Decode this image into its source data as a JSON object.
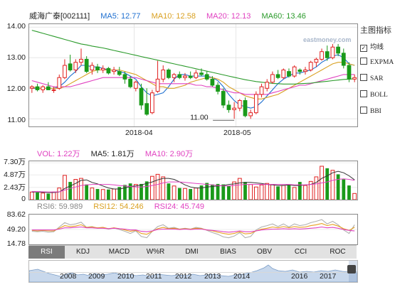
{
  "header": {
    "name": "威海广泰[002111]",
    "ma5": "MA5: 12.77",
    "ma10": "MA10: 12.58",
    "ma20": "MA20: 12.13",
    "ma60": "MA60: 13.46"
  },
  "price_axis": {
    "ticks": [
      "14.00",
      "13.00",
      "12.00",
      "11.00"
    ]
  },
  "date_axis": {
    "ticks": [
      "2018-04",
      "2018-05"
    ]
  },
  "annotations": {
    "low": "11.00"
  },
  "watermark": "eastmoney.com",
  "side_panel": {
    "title": "主图指标",
    "items": [
      {
        "label": "均线",
        "checked": true
      },
      {
        "label": "EXPMA",
        "checked": false
      },
      {
        "label": "SAR",
        "checked": false
      },
      {
        "label": "BOLL",
        "checked": false
      },
      {
        "label": "BBI",
        "checked": false
      }
    ]
  },
  "volume": {
    "legend": {
      "vol": "VOL: 1.22万",
      "ma5": "MA5: 1.81万",
      "ma10": "MA10: 2.90万"
    },
    "ticks": [
      "7.30万",
      "4.87万",
      "2.43万",
      "0"
    ]
  },
  "rsi": {
    "legend": {
      "rsi6": "RSI6: 59.989",
      "rsi12": "RSI12: 54.246",
      "rsi24": "RSI24: 45.749"
    },
    "ticks": [
      "83.62",
      "49.20",
      "14.78"
    ]
  },
  "tabs": [
    "RSI",
    "KDJ",
    "MACD",
    "W%R",
    "DMI",
    "BIAS",
    "OBV",
    "CCI",
    "ROC"
  ],
  "active_tab": "RSI",
  "navigator": {
    "years": [
      "2008",
      "2009",
      "2010",
      "2011",
      "2012",
      "2013",
      "2014",
      "2016",
      "2017"
    ]
  },
  "colors": {
    "up": "#e0201f",
    "down": "#1a9a1a",
    "ma5": "#1e6fd0",
    "ma10": "#d9a020",
    "ma20": "#e040c0",
    "ma60": "#2a9a2a",
    "rsi6": "#b0b0b0",
    "rsi12": "#e8a020",
    "rsi24": "#e040c0"
  },
  "chart_data": [
    {
      "type": "candlestick",
      "title": "威海广泰[002111]",
      "ylim": [
        10.75,
        14.1
      ],
      "x_ticks": [
        "2018-04",
        "2018-05"
      ],
      "candles": [
        {
          "o": 12.0,
          "h": 12.1,
          "l": 11.85,
          "c": 12.05
        },
        {
          "o": 12.05,
          "h": 12.15,
          "l": 11.9,
          "c": 11.95
        },
        {
          "o": 11.95,
          "h": 12.1,
          "l": 11.85,
          "c": 12.05
        },
        {
          "o": 12.05,
          "h": 12.2,
          "l": 11.95,
          "c": 11.95
        },
        {
          "o": 11.95,
          "h": 12.05,
          "l": 11.85,
          "c": 11.95
        },
        {
          "o": 12.0,
          "h": 12.45,
          "l": 11.95,
          "c": 12.35
        },
        {
          "o": 12.35,
          "h": 12.95,
          "l": 12.3,
          "c": 12.75
        },
        {
          "o": 12.8,
          "h": 13.1,
          "l": 12.55,
          "c": 12.6
        },
        {
          "o": 12.6,
          "h": 12.95,
          "l": 12.5,
          "c": 12.85
        },
        {
          "o": 12.85,
          "h": 13.3,
          "l": 12.75,
          "c": 12.95
        },
        {
          "o": 12.95,
          "h": 13.05,
          "l": 12.5,
          "c": 12.55
        },
        {
          "o": 12.6,
          "h": 12.85,
          "l": 12.45,
          "c": 12.75
        },
        {
          "o": 12.7,
          "h": 12.8,
          "l": 12.5,
          "c": 12.6
        },
        {
          "o": 12.6,
          "h": 12.75,
          "l": 12.5,
          "c": 12.65
        },
        {
          "o": 12.65,
          "h": 12.7,
          "l": 12.45,
          "c": 12.5
        },
        {
          "o": 12.55,
          "h": 12.7,
          "l": 12.45,
          "c": 12.6
        },
        {
          "o": 12.55,
          "h": 12.7,
          "l": 12.4,
          "c": 12.45
        },
        {
          "o": 12.45,
          "h": 12.55,
          "l": 12.15,
          "c": 12.3
        },
        {
          "o": 12.3,
          "h": 12.4,
          "l": 12.0,
          "c": 12.05
        },
        {
          "o": 12.0,
          "h": 12.25,
          "l": 11.9,
          "c": 12.2
        },
        {
          "o": 12.0,
          "h": 12.15,
          "l": 11.3,
          "c": 11.45
        },
        {
          "o": 11.5,
          "h": 12.0,
          "l": 11.1,
          "c": 11.15
        },
        {
          "o": 11.2,
          "h": 11.95,
          "l": 11.15,
          "c": 11.85
        },
        {
          "o": 11.9,
          "h": 12.9,
          "l": 11.85,
          "c": 12.3
        },
        {
          "o": 12.3,
          "h": 12.75,
          "l": 12.2,
          "c": 12.6
        },
        {
          "o": 12.6,
          "h": 12.65,
          "l": 12.3,
          "c": 12.35
        },
        {
          "o": 12.35,
          "h": 12.5,
          "l": 12.2,
          "c": 12.45
        },
        {
          "o": 12.45,
          "h": 12.55,
          "l": 12.3,
          "c": 12.35
        },
        {
          "o": 12.35,
          "h": 12.5,
          "l": 12.25,
          "c": 12.4
        },
        {
          "o": 12.4,
          "h": 12.55,
          "l": 12.3,
          "c": 12.35
        },
        {
          "o": 12.35,
          "h": 12.6,
          "l": 12.3,
          "c": 12.5
        },
        {
          "o": 12.5,
          "h": 12.65,
          "l": 12.4,
          "c": 12.45
        },
        {
          "o": 12.45,
          "h": 12.55,
          "l": 12.25,
          "c": 12.3
        },
        {
          "o": 12.3,
          "h": 12.4,
          "l": 12.05,
          "c": 12.1
        },
        {
          "o": 12.1,
          "h": 12.2,
          "l": 11.8,
          "c": 11.9
        },
        {
          "o": 11.9,
          "h": 12.0,
          "l": 11.35,
          "c": 11.45
        },
        {
          "o": 11.45,
          "h": 11.6,
          "l": 11.2,
          "c": 11.3
        },
        {
          "o": 11.3,
          "h": 11.55,
          "l": 11.0,
          "c": 11.35
        },
        {
          "o": 11.35,
          "h": 11.65,
          "l": 11.25,
          "c": 11.6
        },
        {
          "o": 11.6,
          "h": 11.7,
          "l": 11.05,
          "c": 11.1
        },
        {
          "o": 11.1,
          "h": 11.3,
          "l": 11.0,
          "c": 11.2
        },
        {
          "o": 11.2,
          "h": 11.9,
          "l": 11.15,
          "c": 11.8
        },
        {
          "o": 11.8,
          "h": 12.15,
          "l": 11.7,
          "c": 12.05
        },
        {
          "o": 12.0,
          "h": 12.3,
          "l": 11.9,
          "c": 12.2
        },
        {
          "o": 12.2,
          "h": 12.55,
          "l": 12.15,
          "c": 12.45
        },
        {
          "o": 12.45,
          "h": 12.6,
          "l": 12.3,
          "c": 12.35
        },
        {
          "o": 12.35,
          "h": 12.65,
          "l": 12.3,
          "c": 12.6
        },
        {
          "o": 12.55,
          "h": 12.65,
          "l": 12.35,
          "c": 12.4
        },
        {
          "o": 12.4,
          "h": 12.75,
          "l": 12.35,
          "c": 12.7
        },
        {
          "o": 12.6,
          "h": 12.65,
          "l": 12.45,
          "c": 12.55
        },
        {
          "o": 12.55,
          "h": 12.7,
          "l": 12.45,
          "c": 12.6
        },
        {
          "o": 12.6,
          "h": 12.9,
          "l": 12.55,
          "c": 12.85
        },
        {
          "o": 12.85,
          "h": 13.0,
          "l": 12.7,
          "c": 12.95
        },
        {
          "o": 12.95,
          "h": 13.3,
          "l": 12.9,
          "c": 13.2
        },
        {
          "o": 13.2,
          "h": 13.4,
          "l": 12.9,
          "c": 13.0
        },
        {
          "o": 13.0,
          "h": 13.45,
          "l": 12.95,
          "c": 13.35
        },
        {
          "o": 13.35,
          "h": 13.45,
          "l": 13.05,
          "c": 13.15
        },
        {
          "o": 13.15,
          "h": 13.3,
          "l": 12.65,
          "c": 12.75
        },
        {
          "o": 12.75,
          "h": 12.85,
          "l": 12.2,
          "c": 12.3
        },
        {
          "o": 12.3,
          "h": 12.45,
          "l": 12.2,
          "c": 12.35
        }
      ],
      "series": [
        {
          "name": "MA5",
          "values": [
            12.0,
            12.0,
            12.0,
            12.0,
            12.0,
            12.05,
            12.2,
            12.4,
            12.55,
            12.75,
            12.75,
            12.7,
            12.7,
            12.65,
            12.6,
            12.6,
            12.55,
            12.5,
            12.4,
            12.3,
            12.05,
            11.85,
            11.75,
            11.8,
            11.85,
            12.05,
            12.3,
            12.45,
            12.45,
            12.4,
            12.4,
            12.4,
            12.4,
            12.35,
            12.25,
            12.05,
            11.8,
            11.6,
            11.45,
            11.4,
            11.35,
            11.4,
            11.55,
            11.75,
            11.95,
            12.15,
            12.3,
            12.4,
            12.5,
            12.5,
            12.55,
            12.6,
            12.7,
            12.85,
            12.95,
            13.05,
            13.1,
            13.0,
            12.8,
            12.75
          ]
        },
        {
          "name": "MA10",
          "values": [
            12.05,
            12.0,
            12.0,
            12.0,
            12.0,
            12.0,
            12.05,
            12.15,
            12.25,
            12.35,
            12.45,
            12.55,
            12.6,
            12.6,
            12.6,
            12.6,
            12.6,
            12.55,
            12.5,
            12.45,
            12.35,
            12.25,
            12.15,
            12.05,
            12.05,
            12.0,
            12.0,
            12.05,
            12.1,
            12.2,
            12.25,
            12.3,
            12.35,
            12.35,
            12.3,
            12.2,
            12.05,
            11.95,
            11.85,
            11.75,
            11.7,
            11.65,
            11.65,
            11.7,
            11.75,
            11.8,
            11.9,
            12.0,
            12.1,
            12.2,
            12.3,
            12.4,
            12.5,
            12.6,
            12.7,
            12.8,
            12.85,
            12.85,
            12.8,
            12.75
          ]
        },
        {
          "name": "MA20",
          "values": [
            12.25,
            12.2,
            12.15,
            12.1,
            12.05,
            12.05,
            12.05,
            12.05,
            12.1,
            12.15,
            12.2,
            12.25,
            12.3,
            12.35,
            12.35,
            12.35,
            12.35,
            12.35,
            12.35,
            12.35,
            12.3,
            12.25,
            12.2,
            12.15,
            12.15,
            12.15,
            12.15,
            12.15,
            12.15,
            12.15,
            12.1,
            12.1,
            12.05,
            12.05,
            12.0,
            11.95,
            11.9,
            11.85,
            11.85,
            11.8,
            11.8,
            11.8,
            11.8,
            11.8,
            11.85,
            11.9,
            11.95,
            12.0,
            12.05,
            12.1,
            12.1,
            12.15,
            12.2,
            12.25,
            12.3,
            12.35,
            12.4,
            12.45,
            12.45,
            12.45
          ]
        },
        {
          "name": "MA60",
          "values": [
            13.9,
            13.85,
            13.8,
            13.75,
            13.7,
            13.65,
            13.6,
            13.55,
            13.5,
            13.45,
            13.42,
            13.38,
            13.35,
            13.32,
            13.28,
            13.24,
            13.2,
            13.16,
            13.12,
            13.08,
            13.04,
            13.0,
            12.96,
            12.92,
            12.88,
            12.84,
            12.8,
            12.76,
            12.72,
            12.68,
            12.64,
            12.6,
            12.56,
            12.52,
            12.48,
            12.44,
            12.4,
            12.36,
            12.32,
            12.28,
            12.25,
            12.22,
            12.2,
            12.18,
            12.16,
            12.15,
            12.14,
            12.14,
            12.14,
            12.15,
            12.16,
            12.17,
            12.19,
            12.21,
            12.23,
            12.25,
            12.27,
            12.29,
            12.3,
            12.31
          ]
        }
      ]
    },
    {
      "type": "bar",
      "title": "VOL",
      "ylim": [
        0,
        7.3
      ],
      "ylabel": "万",
      "values": [
        1.5,
        1.4,
        1.3,
        1.2,
        1.5,
        2.3,
        4.8,
        3.5,
        4.0,
        4.2,
        3.0,
        2.3,
        2.1,
        2.0,
        2.0,
        2.1,
        2.5,
        2.9,
        3.2,
        3.0,
        3.1,
        3.6,
        4.6,
        5.0,
        4.5,
        3.2,
        2.7,
        2.3,
        2.2,
        2.1,
        2.3,
        2.8,
        3.3,
        3.0,
        3.1,
        3.0,
        2.7,
        3.5,
        4.2,
        3.5,
        3.0,
        2.5,
        2.9,
        3.2,
        3.0,
        2.6,
        2.8,
        3.0,
        2.4,
        3.5,
        2.8,
        3.6,
        4.5,
        6.6,
        6.2,
        5.8,
        5.0,
        4.0,
        2.8,
        1.22
      ],
      "series": [
        {
          "name": "MA5",
          "values": [
            1.5,
            1.5,
            1.45,
            1.4,
            1.4,
            1.5,
            2.2,
            2.7,
            3.2,
            3.8,
            3.9,
            3.4,
            3.1,
            2.7,
            2.3,
            2.1,
            2.1,
            2.3,
            2.6,
            2.7,
            2.9,
            3.2,
            3.5,
            3.9,
            4.2,
            4.2,
            4.0,
            3.5,
            2.9,
            2.5,
            2.3,
            2.3,
            2.5,
            2.6,
            2.7,
            2.8,
            3.0,
            3.1,
            3.3,
            3.4,
            3.4,
            3.3,
            3.2,
            3.0,
            2.9,
            2.8,
            2.8,
            2.9,
            2.8,
            2.8,
            2.9,
            3.0,
            3.4,
            4.2,
            4.7,
            5.3,
            5.6,
            5.3,
            4.7,
            3.9
          ]
        },
        {
          "name": "MA10",
          "values": [
            1.6,
            1.6,
            1.55,
            1.5,
            1.5,
            1.55,
            1.9,
            2.2,
            2.5,
            2.8,
            2.9,
            3.0,
            3.0,
            3.0,
            3.0,
            2.9,
            2.8,
            2.7,
            2.6,
            2.5,
            2.5,
            2.6,
            2.8,
            3.0,
            3.3,
            3.5,
            3.5,
            3.5,
            3.4,
            3.3,
            3.2,
            3.1,
            3.0,
            2.9,
            2.8,
            2.7,
            2.7,
            2.8,
            2.9,
            3.0,
            3.0,
            3.0,
            3.0,
            3.0,
            3.0,
            3.0,
            3.0,
            3.0,
            2.9,
            2.9,
            2.9,
            3.0,
            3.1,
            3.3,
            3.5,
            3.8,
            4.0,
            4.1,
            4.0,
            3.8
          ]
        }
      ]
    },
    {
      "type": "line",
      "title": "RSI",
      "ylim": [
        14.78,
        83.62
      ],
      "series": [
        {
          "name": "RSI6",
          "values": [
            45,
            44,
            45,
            43,
            44,
            55,
            65,
            60,
            62,
            66,
            54,
            56,
            52,
            54,
            50,
            53,
            49,
            45,
            40,
            46,
            33,
            30,
            45,
            56,
            60,
            52,
            54,
            50,
            52,
            50,
            54,
            52,
            47,
            42,
            38,
            32,
            30,
            34,
            42,
            30,
            33,
            48,
            55,
            58,
            62,
            56,
            62,
            55,
            62,
            58,
            60,
            65,
            68,
            72,
            62,
            68,
            60,
            48,
            40,
            59.989
          ]
        },
        {
          "name": "RSI12",
          "values": [
            47,
            46,
            47,
            46,
            46,
            52,
            58,
            56,
            57,
            60,
            54,
            55,
            53,
            54,
            51,
            53,
            51,
            48,
            45,
            47,
            40,
            38,
            45,
            51,
            54,
            51,
            52,
            50,
            51,
            50,
            52,
            51,
            48,
            46,
            43,
            40,
            38,
            40,
            44,
            39,
            40,
            46,
            50,
            52,
            55,
            53,
            56,
            53,
            56,
            54,
            55,
            58,
            60,
            63,
            58,
            61,
            57,
            51,
            47,
            54.246
          ]
        },
        {
          "name": "RSI24",
          "values": [
            48,
            48,
            48,
            48,
            48,
            50,
            53,
            53,
            54,
            55,
            53,
            53,
            52,
            52,
            51,
            52,
            51,
            50,
            48,
            48,
            45,
            44,
            46,
            49,
            50,
            50,
            50,
            49,
            50,
            49,
            50,
            50,
            48,
            47,
            46,
            44,
            43,
            44,
            46,
            44,
            44,
            46,
            48,
            49,
            50,
            50,
            51,
            50,
            51,
            50,
            51,
            52,
            53,
            55,
            53,
            54,
            52,
            49,
            47,
            45.749
          ]
        }
      ]
    }
  ]
}
